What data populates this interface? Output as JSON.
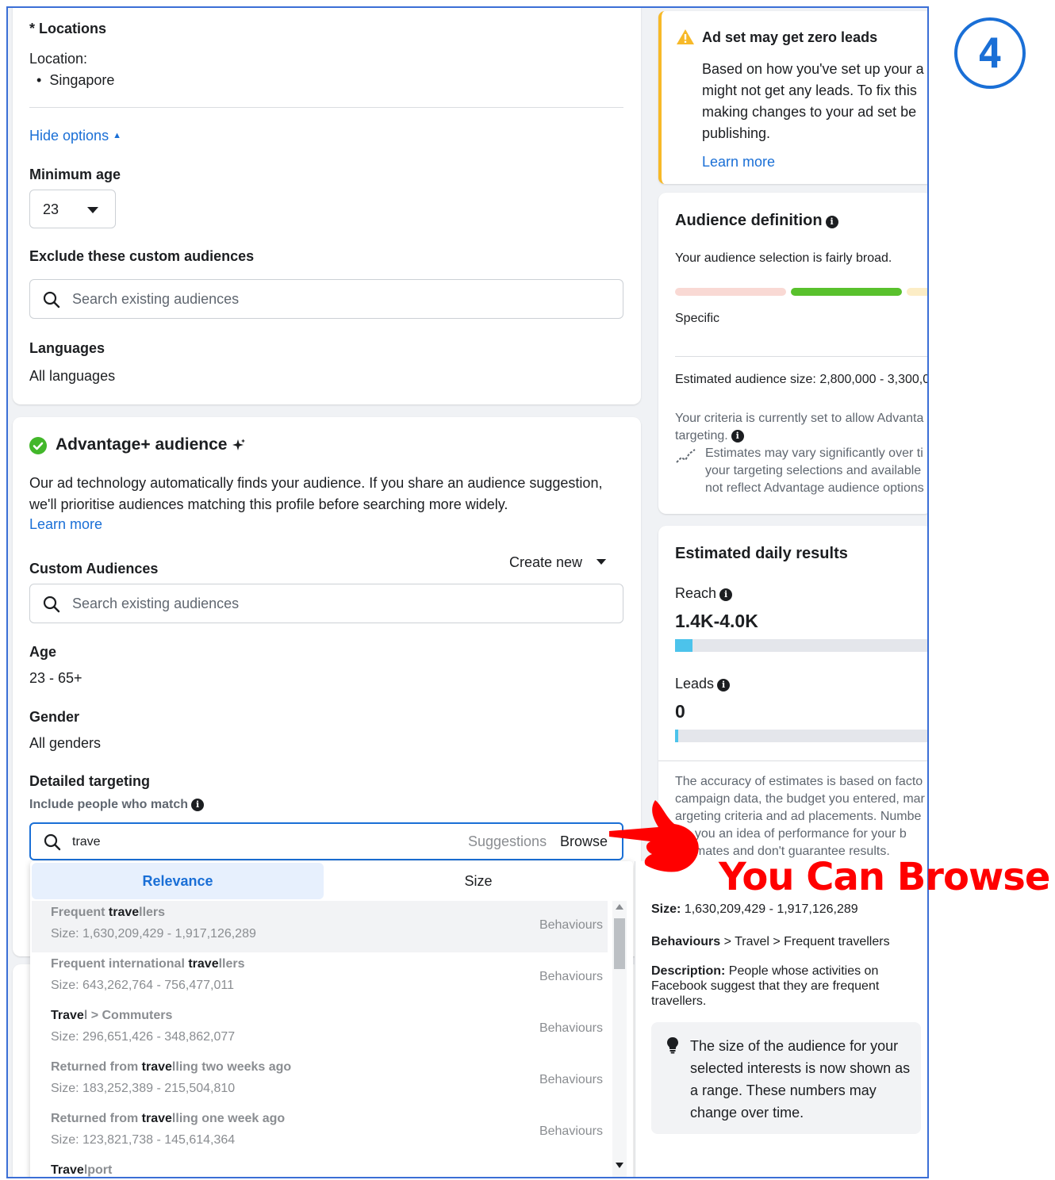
{
  "step_badge": "4",
  "overlay_caption": "You Can Browse",
  "left": {
    "locations_label": "* Locations",
    "location_label": "Location:",
    "location_value": "Singapore",
    "hide_options": "Hide options",
    "min_age_label": "Minimum age",
    "min_age_value": "23",
    "exclude_label": "Exclude these custom audiences",
    "exclude_placeholder": "Search existing audiences",
    "languages_label": "Languages",
    "languages_value": "All languages",
    "advantage_title": "Advantage+ audience",
    "advantage_desc": "Our ad technology automatically finds your audience. If you share an audience suggestion, we'll prioritise audiences matching this profile before searching more widely.",
    "advantage_learn_more": "Learn more",
    "custom_audiences_label": "Custom Audiences",
    "create_new": "Create new",
    "custom_placeholder": "Search existing audiences",
    "age_label": "Age",
    "age_value": "23 - 65+",
    "gender_label": "Gender",
    "gender_value": "All genders",
    "detailed_label": "Detailed targeting",
    "include_label": "Include people who match",
    "targeting_query": "trave",
    "suggestions": "Suggestions",
    "browse": "Browse"
  },
  "dropdown": {
    "tabs": [
      "Relevance",
      "Size"
    ],
    "rows": [
      {
        "pre": "Frequent ",
        "match": "trave",
        "post": "llers",
        "size": "Size: 1,630,209,429 - 1,917,126,289",
        "category": "Behaviours"
      },
      {
        "pre": "Frequent international ",
        "match": "trave",
        "post": "llers",
        "size": "Size: 643,262,764 - 756,477,011",
        "category": "Behaviours"
      },
      {
        "pre": "",
        "match": "Trave",
        "post": "l > Commuters",
        "size": "Size: 296,651,426 - 348,862,077",
        "category": "Behaviours"
      },
      {
        "pre": "Returned from ",
        "match": "trave",
        "post": "lling two weeks ago",
        "size": "Size: 183,252,389 - 215,504,810",
        "category": "Behaviours"
      },
      {
        "pre": "Returned from ",
        "match": "trave",
        "post": "lling one week ago",
        "size": "Size: 123,821,738 - 145,614,364",
        "category": "Behaviours"
      },
      {
        "pre": "",
        "match": "Trave",
        "post": "lport",
        "size": "",
        "category": ""
      }
    ]
  },
  "detail": {
    "size_label": "Size:",
    "size_value": "1,630,209,429 - 1,917,126,289",
    "path_bold": "Behaviours",
    "path_rest": " > Travel > Frequent travellers",
    "desc_label": "Description:",
    "desc_value": "People whose activities on Facebook suggest that they are frequent travellers.",
    "tip": "The size of the audience for your selected interests is now shown as a range. These numbers may change over time."
  },
  "right": {
    "warning_title": "Ad set may get zero leads",
    "warning_body": "Based on how you've set up your a might not get any leads. To fix this making changes to your ad set be publishing.",
    "warning_learn_more": "Learn more",
    "audience_def_title": "Audience definition",
    "audience_broad": "Your audience selection is fairly broad.",
    "specific": "Specific",
    "est_size": "Estimated audience size: 2,800,000 - 3,300,0",
    "criteria": "Your criteria is currently set to allow Advanta targeting.",
    "estimates_vary": "Estimates may vary significantly over ti your targeting selections and available not reflect Advantage audience options",
    "daily_title": "Estimated daily results",
    "reach_label": "Reach",
    "reach_value": "1.4K-4.0K",
    "leads_label": "Leads",
    "leads_value": "0",
    "accuracy": "The accuracy of estimates is based on facto campaign data, the budget you entered, mar argeting criteria and ad placements. Numbe ive you an idea of performance for your b estimates and don't guarantee results."
  },
  "colors": {
    "accent_blue": "#1a6fd6",
    "warning_yellow": "#f7b928",
    "success_green": "#42b72a",
    "arrow_red": "#ff0000"
  }
}
